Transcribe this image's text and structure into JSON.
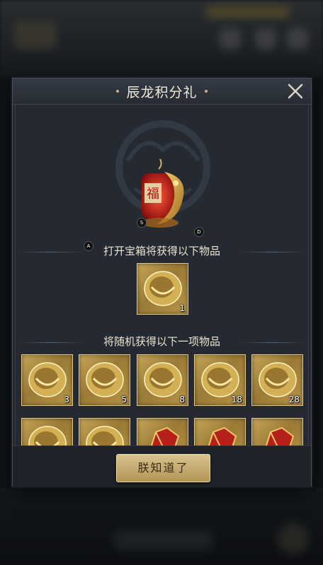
{
  "dialog": {
    "title": "辰龙积分礼",
    "close_icon": "close-icon"
  },
  "chest": {
    "icon": "dragon-lantern-chest-icon",
    "glyph": "福",
    "markers": [
      "S",
      "D",
      "A"
    ]
  },
  "guaranteed": {
    "label": "打开宝箱将获得以下物品",
    "items": [
      {
        "icon": "gold-coin-icon",
        "qty": "1"
      }
    ]
  },
  "random": {
    "label": "将随机获得以下一项物品",
    "row1": [
      {
        "icon": "gold-coin-icon",
        "qty": "3"
      },
      {
        "icon": "gold-coin-icon",
        "qty": "5"
      },
      {
        "icon": "gold-coin-icon",
        "qty": "8"
      },
      {
        "icon": "gold-coin-icon",
        "qty": "18"
      },
      {
        "icon": "gold-coin-icon",
        "qty": "28"
      }
    ],
    "row2": [
      {
        "icon": "gold-coin-icon"
      },
      {
        "icon": "gold-coin-icon"
      },
      {
        "icon": "red-armor-icon"
      },
      {
        "icon": "red-armor-icon"
      },
      {
        "icon": "red-armor-icon"
      }
    ]
  },
  "footer": {
    "confirm_label": "朕知道了"
  },
  "colors": {
    "panel": "#252a32",
    "gold": "#c7a658",
    "button": "#d8c28e"
  }
}
